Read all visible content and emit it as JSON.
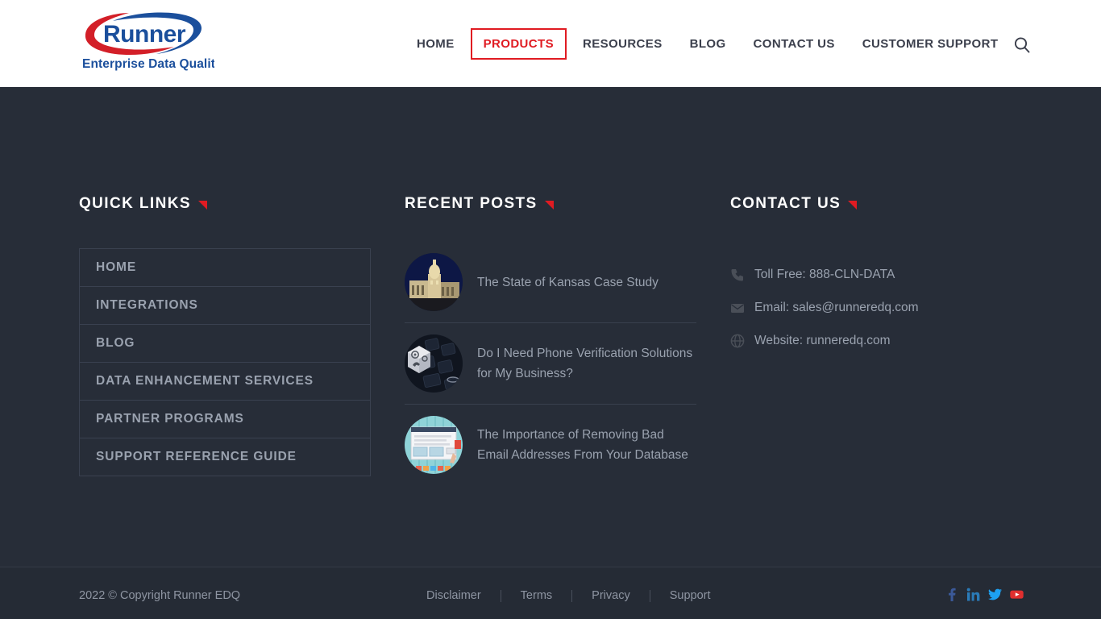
{
  "header": {
    "logo": {
      "wordmark": "Runner",
      "trademark": "™",
      "tagline": "Enterprise Data Quality"
    },
    "nav": [
      {
        "label": "HOME",
        "active": false
      },
      {
        "label": "PRODUCTS",
        "active": true
      },
      {
        "label": "RESOURCES",
        "active": false
      },
      {
        "label": "BLOG",
        "active": false
      },
      {
        "label": "CONTACT US",
        "active": false
      },
      {
        "label": "CUSTOMER SUPPORT",
        "active": false
      }
    ],
    "search_icon": "search-icon"
  },
  "footer": {
    "quick_links": {
      "title": "QUICK LINKS",
      "items": [
        {
          "label": "HOME"
        },
        {
          "label": "INTEGRATIONS"
        },
        {
          "label": "BLOG"
        },
        {
          "label": "DATA ENHANCEMENT SERVICES"
        },
        {
          "label": "PARTNER PROGRAMS"
        },
        {
          "label": "SUPPORT REFERENCE GUIDE"
        }
      ]
    },
    "recent_posts": {
      "title": "RECENT POSTS",
      "items": [
        {
          "title": "The State of Kansas Case Study",
          "thumb": "capitol-building-thumbnail"
        },
        {
          "title": "Do I Need Phone Verification Solutions for My Business?",
          "thumb": "phone-dice-keyboard-thumbnail"
        },
        {
          "title": "The Importance of Removing Bad Email Addresses From Your Database",
          "thumb": "desktop-window-thumbnail"
        }
      ]
    },
    "contact": {
      "title": "CONTACT US",
      "items": [
        {
          "icon": "phone-icon",
          "text": "Toll Free:  888-CLN-DATA"
        },
        {
          "icon": "email-icon",
          "text": "Email: sales@runneredq.com"
        },
        {
          "icon": "globe-icon",
          "text": "Website: runneredq.com"
        }
      ]
    },
    "bottom": {
      "copyright": "2022 © Copyright Runner EDQ",
      "legal": [
        {
          "label": "Disclaimer"
        },
        {
          "label": "Terms"
        },
        {
          "label": "Privacy"
        },
        {
          "label": "Support"
        }
      ],
      "socials": [
        {
          "name": "facebook-icon",
          "color": "#3b5998"
        },
        {
          "name": "linkedin-icon",
          "color": "#2a7bb8"
        },
        {
          "name": "twitter-icon",
          "color": "#1da1f2"
        },
        {
          "name": "youtube-icon",
          "color": "#e02f2f"
        }
      ]
    }
  },
  "colors": {
    "accent_red": "#e01b22",
    "logo_blue": "#1b4f9c",
    "footer_bg": "#272d38",
    "footer_bottom_bg": "#252b35",
    "muted_text": "#9aa2af",
    "header_bg": "#ffffff"
  }
}
